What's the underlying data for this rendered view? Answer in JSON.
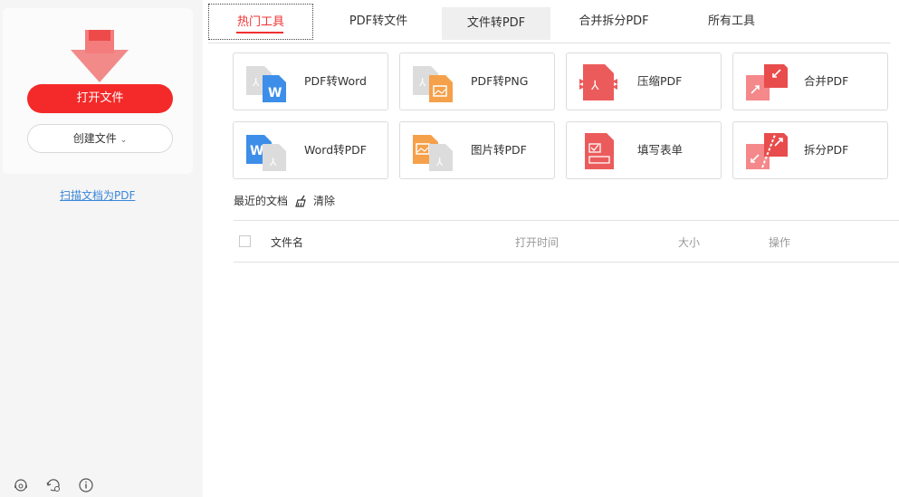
{
  "sidebar": {
    "open_file": "打开文件",
    "create_file": "创建文件",
    "scan_link": "扫描文档为PDF",
    "bottom_icons": [
      "support-icon",
      "settings-sync-icon",
      "info-icon"
    ]
  },
  "tabs": [
    {
      "label": "热门工具",
      "active": true
    },
    {
      "label": "PDF转文件"
    },
    {
      "label": "文件转PDF",
      "hover": true
    },
    {
      "label": "合并拆分PDF"
    },
    {
      "label": "所有工具"
    }
  ],
  "tools": [
    {
      "label": "PDF转Word",
      "icon": "pdf-to-word-icon"
    },
    {
      "label": "PDF转PNG",
      "icon": "pdf-to-png-icon"
    },
    {
      "label": "压缩PDF",
      "icon": "compress-pdf-icon"
    },
    {
      "label": "合并PDF",
      "icon": "merge-pdf-icon"
    },
    {
      "label": "Word转PDF",
      "icon": "word-to-pdf-icon"
    },
    {
      "label": "图片转PDF",
      "icon": "image-to-pdf-icon"
    },
    {
      "label": "填写表单",
      "icon": "fill-form-icon"
    },
    {
      "label": "拆分PDF",
      "icon": "split-pdf-icon"
    }
  ],
  "recent": {
    "title": "最近的文档",
    "clear": "清除",
    "columns": [
      "文件名",
      "打开时间",
      "大小",
      "操作"
    ]
  },
  "colors": {
    "accent": "#f42a2a",
    "link": "#3a86d9",
    "blue": "#3d8ee8",
    "orange": "#f5a04a",
    "red_icon": "#ec5b5b"
  }
}
